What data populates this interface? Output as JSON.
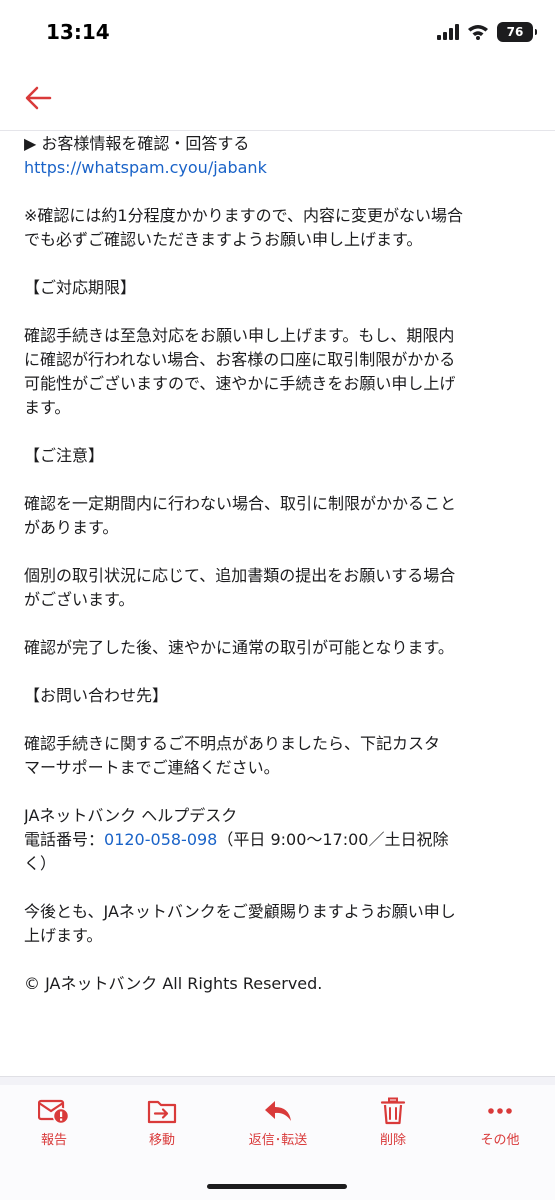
{
  "status_bar": {
    "time": "13:14",
    "battery": "76"
  },
  "email": {
    "paragraphs": [
      {
        "lines": [
          "▶ お客様情報を確認・回答する"
        ],
        "link": "https://whatspam.cyou/jabank"
      },
      {
        "lines": [
          "※確認には約1分程度かかりますので、内容に変更がない場合",
          "でも必ずご確認いただきますようお願い申し上げます。"
        ]
      },
      {
        "lines": [
          "【ご対応期限】"
        ]
      },
      {
        "lines": [
          "確認手続きは至急対応をお願い申し上げます。もし、期限内",
          "に確認が行われない場合、お客様の口座に取引制限がかかる",
          "可能性がございますので、速やかに手続きをお願い申し上げ",
          "ます。"
        ]
      },
      {
        "lines": [
          "【ご注意】"
        ]
      },
      {
        "lines": [
          "確認を一定期間内に行わない場合、取引に制限がかかること",
          "があります。"
        ]
      },
      {
        "lines": [
          "個別の取引状況に応じて、追加書類の提出をお願いする場合",
          "がございます。"
        ]
      },
      {
        "lines": [
          "確認が完了した後、速やかに通常の取引が可能となります。"
        ]
      },
      {
        "lines": [
          "【お問い合わせ先】"
        ]
      },
      {
        "lines": [
          "確認手続きに関するご不明点がありましたら、下記カスタ",
          "マーサポートまでご連絡ください。"
        ]
      },
      {
        "lines": [
          "今後とも、JAネットバンクをご愛顧賜りますようお願い申し",
          "上げます。"
        ]
      },
      {
        "lines": [
          "© JAネットバンク All Rights Reserved."
        ]
      }
    ],
    "contact": {
      "name": "JAネットバンク ヘルプデスク",
      "phone_label": "電話番号：",
      "phone": "0120-058-098",
      "hours_1": "（平日 9:00〜17:00／土日祝除",
      "hours_2": "く）"
    }
  },
  "toolbar": {
    "report": {
      "label": "報告",
      "icon": "report-spam-icon"
    },
    "move": {
      "label": "移動",
      "icon": "move-folder-icon"
    },
    "reply": {
      "label": "返信･転送",
      "icon": "reply-icon"
    },
    "delete": {
      "label": "削除",
      "icon": "trash-icon"
    },
    "more": {
      "label": "その他",
      "icon": "more-dots-icon"
    }
  },
  "colors": {
    "accent": "#d93a3a",
    "link": "#1a63c8"
  }
}
